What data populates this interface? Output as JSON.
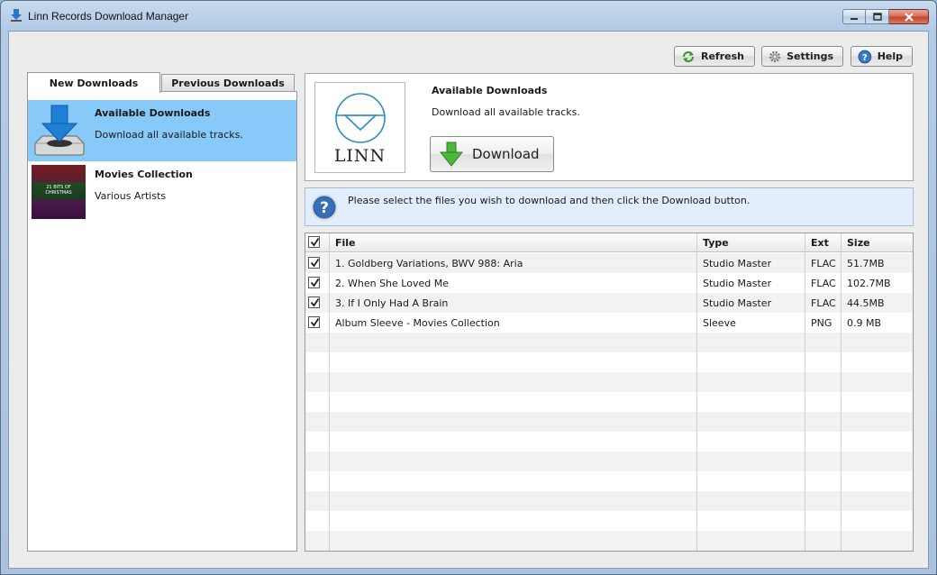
{
  "window": {
    "title": "Linn Records Download Manager"
  },
  "toolbar": {
    "refresh_label": "Refresh",
    "settings_label": "Settings",
    "help_label": "Help"
  },
  "tabs": [
    {
      "label": "New Downloads",
      "active": true
    },
    {
      "label": "Previous Downloads",
      "active": false
    }
  ],
  "downloads_list": [
    {
      "title": "Available Downloads",
      "subtitle": "Download all available tracks.",
      "selected": true
    },
    {
      "title": "Movies Collection",
      "subtitle": "Various Artists",
      "selected": false,
      "thumb_text": "21 BITS OF CHRISTMAS"
    }
  ],
  "info": {
    "logo_text": "LINN",
    "title": "Available Downloads",
    "subtitle": "Download all available tracks.",
    "download_label": "Download"
  },
  "message": {
    "text": "Please select the files you wish to download and then click the Download button."
  },
  "files_table": {
    "columns": [
      "File",
      "Type",
      "Ext",
      "Size"
    ],
    "rows": [
      {
        "file": "1. Goldberg Variations, BWV 988: Aria",
        "type": "Studio Master",
        "ext": "FLAC",
        "size": "51.7MB",
        "checked": true
      },
      {
        "file": "2. When She Loved Me",
        "type": "Studio Master",
        "ext": "FLAC",
        "size": "102.7MB",
        "checked": true
      },
      {
        "file": "3. If I Only Had A Brain",
        "type": "Studio Master",
        "ext": "FLAC",
        "size": "44.5MB",
        "checked": true
      },
      {
        "file": "Album Sleeve - Movies Collection",
        "type": "Sleeve",
        "ext": "PNG",
        "size": "0.9 MB",
        "checked": true
      }
    ]
  },
  "colors": {
    "selection": "#87c9f8",
    "message_bg": "#e2eefb",
    "download_arrow": "#3fae2a"
  },
  "icons": {
    "title": "download-arrow-icon",
    "refresh": "refresh-icon",
    "settings": "gear-icon",
    "help": "help-icon",
    "download": "green-down-arrow-icon",
    "message": "question-icon"
  }
}
